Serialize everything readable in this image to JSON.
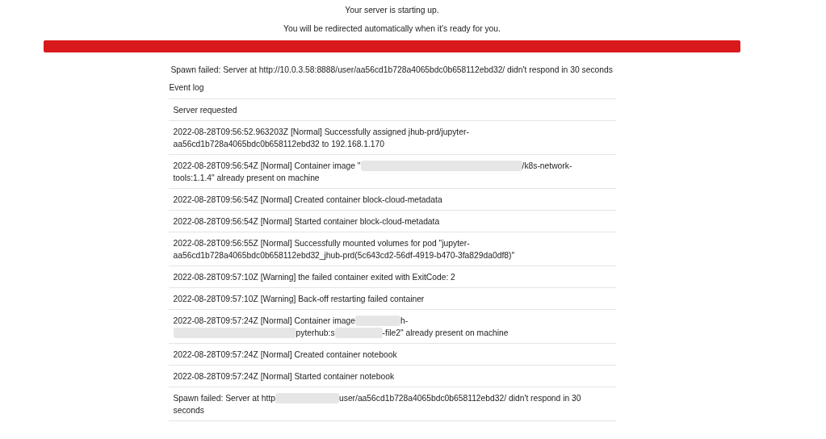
{
  "header": {
    "title": "Your server is starting up.",
    "subtitle": "You will be redirected automatically when it's ready for you."
  },
  "progress": {
    "level": 1,
    "color": "#d9191c"
  },
  "message": "Spawn failed: Server at http://10.0.3.58:8888/user/aa56cd1b728a4065bdc0b658112ebd32/ didn't respond in 30 seconds",
  "event_log": {
    "label": "Event log",
    "events": [
      {
        "lines": [
          [
            {
              "kind": "text",
              "text": "Server requested"
            }
          ]
        ]
      },
      {
        "lines": [
          [
            {
              "kind": "text",
              "text": "2022-08-28T09:56:52.963203Z [Normal] Successfully assigned jhub-prd/jupyter-"
            }
          ],
          [
            {
              "kind": "text",
              "text": "aa56cd1b728a4065bdc0b658112ebd32 to 192.168.1.170"
            }
          ]
        ]
      },
      {
        "lines": [
          [
            {
              "kind": "text",
              "text": "2022-08-28T09:56:54Z [Normal] Container image \""
            },
            {
              "kind": "redacted"
            },
            {
              "kind": "text",
              "text": "/k8s-network-"
            }
          ],
          [
            {
              "kind": "text",
              "text": "tools:1.1.4\" already present on machine"
            }
          ]
        ]
      },
      {
        "lines": [
          [
            {
              "kind": "text",
              "text": "2022-08-28T09:56:54Z [Normal] Created container block-cloud-metadata"
            }
          ]
        ]
      },
      {
        "lines": [
          [
            {
              "kind": "text",
              "text": "2022-08-28T09:56:54Z [Normal] Started container block-cloud-metadata"
            }
          ]
        ]
      },
      {
        "lines": [
          [
            {
              "kind": "text",
              "text": "2022-08-28T09:56:55Z [Normal] Successfully mounted volumes for pod \"jupyter-"
            }
          ],
          [
            {
              "kind": "text",
              "text": "aa56cd1b728a4065bdc0b658112ebd32_jhub-prd(5c643cd2-56df-4919-b470-3fa829da0df8)\""
            }
          ]
        ]
      },
      {
        "lines": [
          [
            {
              "kind": "text",
              "text": "2022-08-28T09:57:10Z [Warning] the failed container exited with ExitCode: 2"
            }
          ]
        ]
      },
      {
        "lines": [
          [
            {
              "kind": "text",
              "text": "2022-08-28T09:57:10Z [Warning] Back-off restarting failed container"
            }
          ]
        ]
      },
      {
        "lines": [
          [
            {
              "kind": "text",
              "text": "2022-08-28T09:57:24Z [Normal] Container image"
            },
            {
              "kind": "redacted"
            },
            {
              "kind": "text",
              "text": "h-"
            }
          ],
          [
            {
              "kind": "redacted"
            },
            {
              "kind": "text",
              "text": "pyterhub:s"
            },
            {
              "kind": "redacted"
            },
            {
              "kind": "text",
              "text": "-file2\" already present on machine"
            }
          ]
        ]
      },
      {
        "lines": [
          [
            {
              "kind": "text",
              "text": "2022-08-28T09:57:24Z [Normal] Created container notebook"
            }
          ]
        ]
      },
      {
        "lines": [
          [
            {
              "kind": "text",
              "text": "2022-08-28T09:57:24Z [Normal] Started container notebook"
            }
          ]
        ]
      },
      {
        "lines": [
          [
            {
              "kind": "text",
              "text": "Spawn failed: Server at http"
            },
            {
              "kind": "redacted"
            },
            {
              "kind": "text",
              "text": "user/aa56cd1b728a4065bdc0b658112ebd32/ didn't respond in 30"
            }
          ],
          [
            {
              "kind": "text",
              "text": "seconds"
            }
          ]
        ]
      }
    ]
  }
}
